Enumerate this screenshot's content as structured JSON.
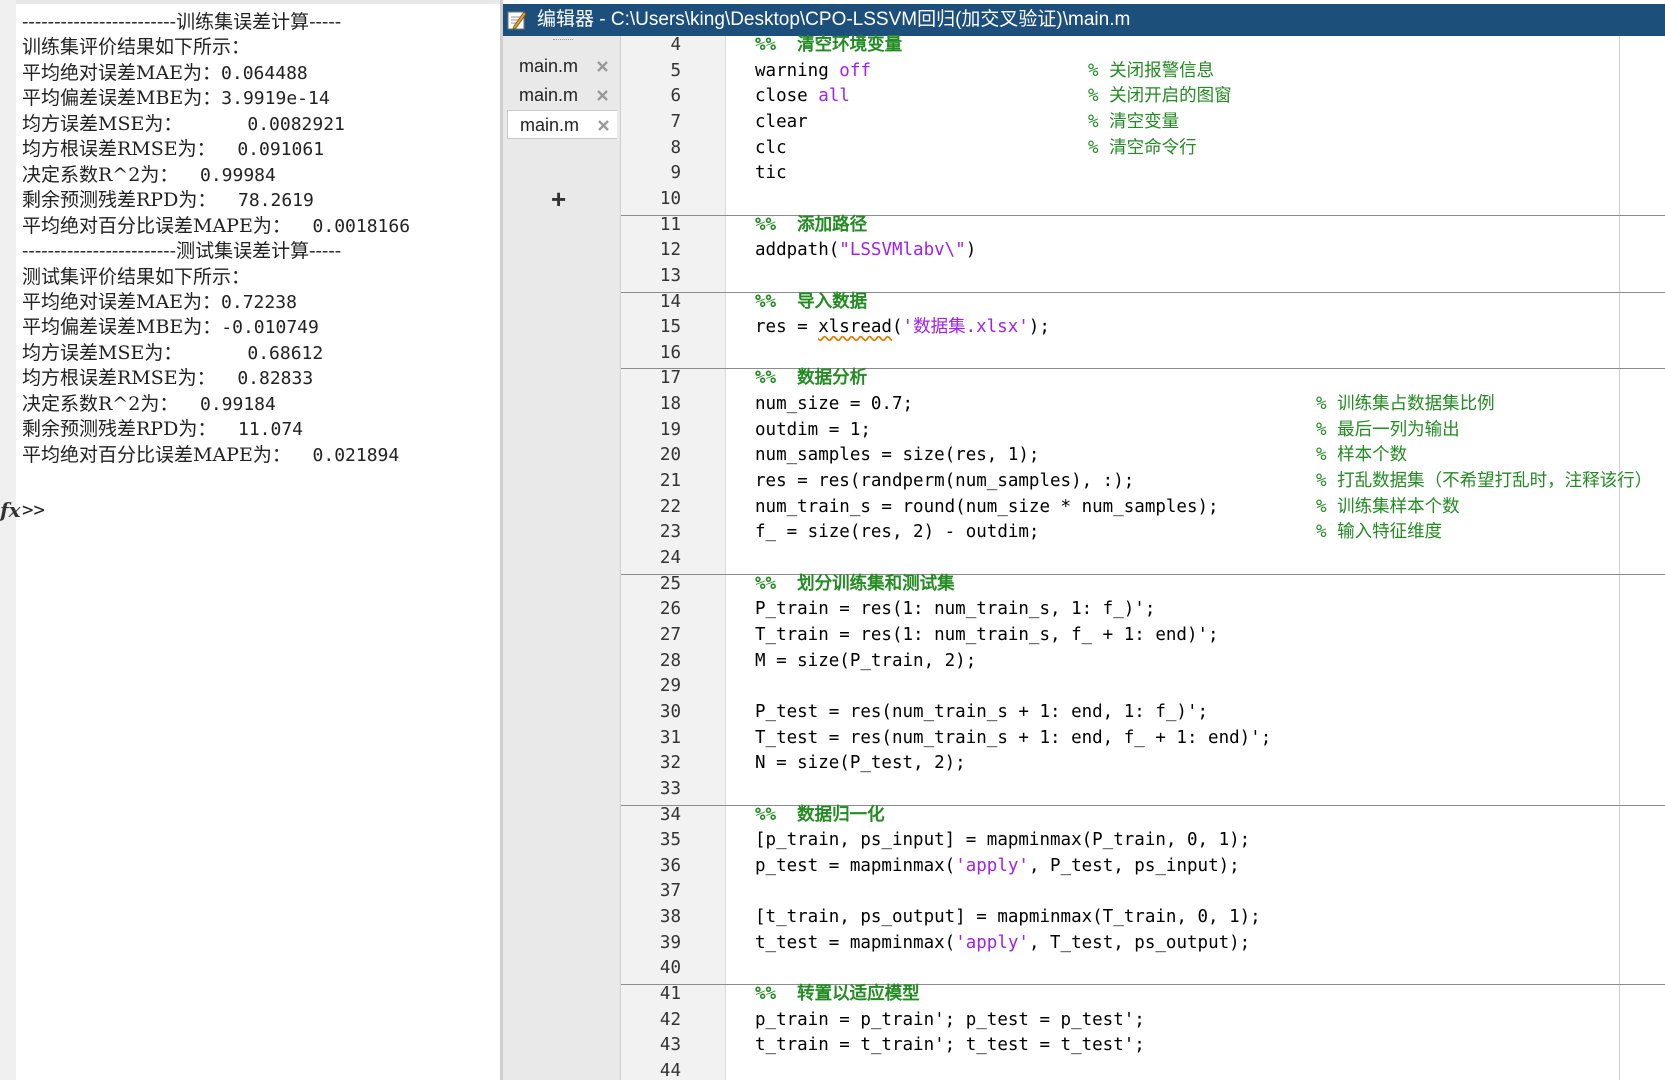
{
  "command_window": {
    "lines": [
      {
        "text": "------------------------训练集误差计算-----"
      },
      {
        "text": "训练集评价结果如下所示："
      },
      {
        "label": "平均绝对误差MAE为：",
        "value": "0.064488"
      },
      {
        "label": "平均偏差误差MBE为：",
        "value": "3.9919e-14"
      },
      {
        "label": "均方误差MSE为：",
        "value": "      0.0082921"
      },
      {
        "label": "均方根误差RMSE为：",
        "value": "  0.091061"
      },
      {
        "label": "决定系数R^2为：",
        "value": "  0.99984"
      },
      {
        "label": "剩余预测残差RPD为：",
        "value": "  78.2619"
      },
      {
        "label": "平均绝对百分比误差MAPE为：",
        "value": "  0.0018166"
      },
      {
        "text": "------------------------测试集误差计算-----"
      },
      {
        "text": "测试集评价结果如下所示："
      },
      {
        "label": "平均绝对误差MAE为：",
        "value": "0.72238"
      },
      {
        "label": "平均偏差误差MBE为：",
        "value": "-0.010749"
      },
      {
        "label": "均方误差MSE为：",
        "value": "      0.68612"
      },
      {
        "label": "均方根误差RMSE为：",
        "value": "  0.82833"
      },
      {
        "label": "决定系数R^2为：",
        "value": "  0.99184"
      },
      {
        "label": "剩余预测残差RPD为：",
        "value": "  11.074"
      },
      {
        "label": "平均绝对百分比误差MAPE为：",
        "value": "  0.021894"
      }
    ],
    "fx_icon": "fx",
    "prompt": ">>"
  },
  "editor": {
    "title": "编辑器 - C:\\Users\\king\\Desktop\\CPO-LSSVM回归(加交叉验证)\\main.m",
    "title_icon": "pencil-editor-icon",
    "tabs": [
      {
        "label": "main.m",
        "active": false
      },
      {
        "label": "main.m",
        "active": false
      },
      {
        "label": "main.m",
        "active": true
      }
    ],
    "tab_add": "+",
    "code_lines": [
      {
        "n": "4",
        "tokens": [
          [
            "sec",
            "%%  清空环境变量"
          ]
        ]
      },
      {
        "n": "5",
        "tokens": [
          [
            "plain",
            "warning "
          ],
          [
            "kw",
            "off"
          ]
        ],
        "comment": "% 关闭报警信息",
        "cc": 1
      },
      {
        "n": "6",
        "tokens": [
          [
            "plain",
            "close "
          ],
          [
            "kw",
            "all"
          ]
        ],
        "comment": "% 关闭开启的图窗",
        "cc": 1
      },
      {
        "n": "7",
        "tokens": [
          [
            "plain",
            "clear"
          ]
        ],
        "comment": "% 清空变量",
        "cc": 1
      },
      {
        "n": "8",
        "tokens": [
          [
            "plain",
            "clc"
          ]
        ],
        "comment": "% 清空命令行",
        "cc": 1
      },
      {
        "n": "9",
        "tokens": [
          [
            "plain",
            "tic"
          ]
        ]
      },
      {
        "n": "10",
        "tokens": [],
        "sep_after": true
      },
      {
        "n": "11",
        "tokens": [
          [
            "sec",
            "%%  添加路径"
          ]
        ]
      },
      {
        "n": "12",
        "tokens": [
          [
            "plain",
            "addpath("
          ],
          [
            "str",
            "\"LSSVMlabv\\\""
          ],
          [
            "plain",
            ")"
          ]
        ]
      },
      {
        "n": "13",
        "tokens": [],
        "sep_after": true
      },
      {
        "n": "14",
        "tokens": [
          [
            "sec",
            "%%  导入数据"
          ]
        ]
      },
      {
        "n": "15",
        "tokens": [
          [
            "plain",
            "res = "
          ],
          [
            "und",
            "xlsread"
          ],
          [
            "plain",
            "("
          ],
          [
            "str",
            "'数据集.xlsx'"
          ],
          [
            "plain",
            ");"
          ]
        ]
      },
      {
        "n": "16",
        "tokens": [],
        "sep_after": true
      },
      {
        "n": "17",
        "tokens": [
          [
            "sec",
            "%%  数据分析"
          ]
        ]
      },
      {
        "n": "18",
        "tokens": [
          [
            "plain",
            "num_size = 0.7;"
          ]
        ],
        "comment": "% 训练集占数据集比例",
        "cc": 2
      },
      {
        "n": "19",
        "tokens": [
          [
            "plain",
            "outdim = 1;"
          ]
        ],
        "comment": "% 最后一列为输出",
        "cc": 2
      },
      {
        "n": "20",
        "tokens": [
          [
            "plain",
            "num_samples = size(res, 1);"
          ]
        ],
        "comment": "% 样本个数",
        "cc": 2
      },
      {
        "n": "21",
        "tokens": [
          [
            "plain",
            "res = res(randperm(num_samples), :);"
          ]
        ],
        "comment": "% 打乱数据集（不希望打乱时，注释该行）",
        "cc": 2
      },
      {
        "n": "22",
        "tokens": [
          [
            "plain",
            "num_train_s = round(num_size * num_samples);"
          ]
        ],
        "comment": "% 训练集样本个数",
        "cc": 2
      },
      {
        "n": "23",
        "tokens": [
          [
            "plain",
            "f_ = size(res, 2) - outdim;"
          ]
        ],
        "comment": "% 输入特征维度",
        "cc": 2
      },
      {
        "n": "24",
        "tokens": [],
        "sep_after": true
      },
      {
        "n": "25",
        "tokens": [
          [
            "sec",
            "%%  划分训练集和测试集"
          ]
        ]
      },
      {
        "n": "26",
        "tokens": [
          [
            "plain",
            "P_train = res(1: num_train_s, 1: f_)';"
          ]
        ]
      },
      {
        "n": "27",
        "tokens": [
          [
            "plain",
            "T_train = res(1: num_train_s, f_ + 1: end)';"
          ]
        ]
      },
      {
        "n": "28",
        "tokens": [
          [
            "plain",
            "M = size(P_train, 2);"
          ]
        ]
      },
      {
        "n": "29",
        "tokens": []
      },
      {
        "n": "30",
        "tokens": [
          [
            "plain",
            "P_test = res(num_train_s + 1: end, 1: f_)';"
          ]
        ]
      },
      {
        "n": "31",
        "tokens": [
          [
            "plain",
            "T_test = res(num_train_s + 1: end, f_ + 1: end)';"
          ]
        ]
      },
      {
        "n": "32",
        "tokens": [
          [
            "plain",
            "N = size(P_test, 2);"
          ]
        ]
      },
      {
        "n": "33",
        "tokens": [],
        "sep_after": true
      },
      {
        "n": "34",
        "tokens": [
          [
            "sec",
            "%%  数据归一化"
          ]
        ]
      },
      {
        "n": "35",
        "tokens": [
          [
            "plain",
            "[p_train, ps_input] = mapminmax(P_train, 0, 1);"
          ]
        ]
      },
      {
        "n": "36",
        "tokens": [
          [
            "plain",
            "p_test = mapminmax("
          ],
          [
            "str",
            "'apply'"
          ],
          [
            "plain",
            ", P_test, ps_input);"
          ]
        ]
      },
      {
        "n": "37",
        "tokens": []
      },
      {
        "n": "38",
        "tokens": [
          [
            "plain",
            "[t_train, ps_output] = mapminmax(T_train, 0, 1);"
          ]
        ]
      },
      {
        "n": "39",
        "tokens": [
          [
            "plain",
            "t_test = mapminmax("
          ],
          [
            "str",
            "'apply'"
          ],
          [
            "plain",
            ", T_test, ps_output);"
          ]
        ]
      },
      {
        "n": "40",
        "tokens": [],
        "sep_after": true
      },
      {
        "n": "41",
        "tokens": [
          [
            "sec",
            "%%  转置以适应模型"
          ]
        ]
      },
      {
        "n": "42",
        "tokens": [
          [
            "plain",
            "p_train = p_train'; p_test = p_test';"
          ]
        ]
      },
      {
        "n": "43",
        "tokens": [
          [
            "plain",
            "t_train = t_train'; t_test = t_test';"
          ]
        ]
      },
      {
        "n": "44",
        "tokens": []
      }
    ]
  }
}
